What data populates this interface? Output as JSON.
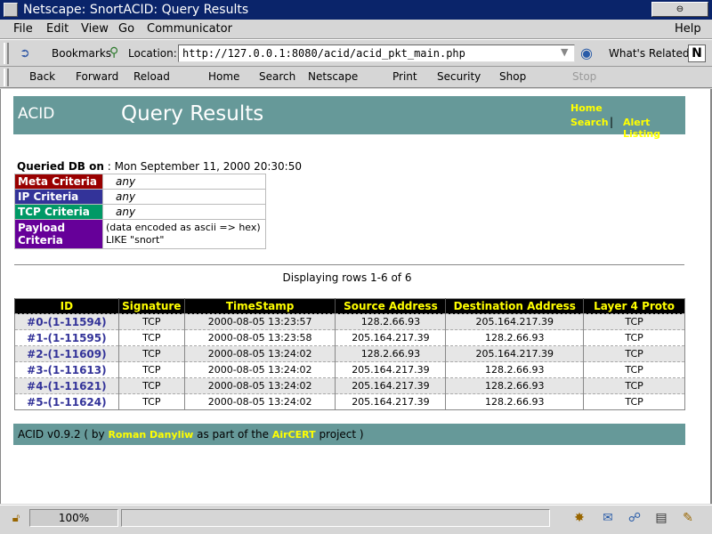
{
  "window": {
    "title": "Netscape: SnortACID: Query Results",
    "control_label": "⊖"
  },
  "menubar": [
    "File",
    "Edit",
    "View",
    "Go",
    "Communicator",
    "Help"
  ],
  "location_bar": {
    "bookmarks_label": "Bookmarks",
    "location_label": "Location:",
    "url": "http://127.0.0.1:8080/acid/acid_pkt_main.php",
    "related_label": "What's Related",
    "logo": "N"
  },
  "nav_toolbar": [
    "Back",
    "Forward",
    "Reload",
    "Home",
    "Search",
    "Netscape",
    "Print",
    "Security",
    "Shop",
    "Stop"
  ],
  "page": {
    "banner": {
      "logo": "ACID",
      "title": "Query Results",
      "links": {
        "home": "Home",
        "search": "Search",
        "separator": "|",
        "alert_listing": "Alert Listing"
      }
    },
    "queried": {
      "label": "Queried DB on",
      "value": " : Mon September 11, 2000 20:30:50"
    },
    "criteria": [
      {
        "label": "Meta Criteria",
        "value": "any",
        "color": "#990000"
      },
      {
        "label": "IP Criteria",
        "value": "any",
        "color": "#333399"
      },
      {
        "label": "TCP Criteria",
        "value": "any",
        "color": "#009966"
      },
      {
        "label": "Payload Criteria",
        "value_line1": "(data encoded as ascii => hex)",
        "value_line2": "LIKE \"snort\"",
        "color": "#660099"
      }
    ],
    "row_count": "Displaying rows 1-6 of 6",
    "table": {
      "headers": [
        "ID",
        "Signature",
        "TimeStamp",
        "Source Address",
        "Destination Address",
        "Layer 4 Proto"
      ],
      "rows": [
        [
          "#0-(1-11594)",
          "TCP",
          "2000-08-05 13:23:57",
          "128.2.66.93",
          "205.164.217.39",
          "TCP"
        ],
        [
          "#1-(1-11595)",
          "TCP",
          "2000-08-05 13:23:58",
          "205.164.217.39",
          "128.2.66.93",
          "TCP"
        ],
        [
          "#2-(1-11609)",
          "TCP",
          "2000-08-05 13:24:02",
          "128.2.66.93",
          "205.164.217.39",
          "TCP"
        ],
        [
          "#3-(1-11613)",
          "TCP",
          "2000-08-05 13:24:02",
          "205.164.217.39",
          "128.2.66.93",
          "TCP"
        ],
        [
          "#4-(1-11621)",
          "TCP",
          "2000-08-05 13:24:02",
          "205.164.217.39",
          "128.2.66.93",
          "TCP"
        ],
        [
          "#5-(1-11624)",
          "TCP",
          "2000-08-05 13:24:02",
          "205.164.217.39",
          "128.2.66.93",
          "TCP"
        ]
      ]
    },
    "footer": {
      "prefix": "ACID v0.9.2 ( by ",
      "author": "Roman Danyliw",
      "middle": " as part of the ",
      "project": "AirCERT",
      "suffix": " project )"
    }
  },
  "status_bar": {
    "zoom": "100%"
  },
  "colors": {
    "banner": "#669999",
    "link_yellow": "#ffff00",
    "header_bg": "#000000",
    "id_link": "#333399"
  }
}
